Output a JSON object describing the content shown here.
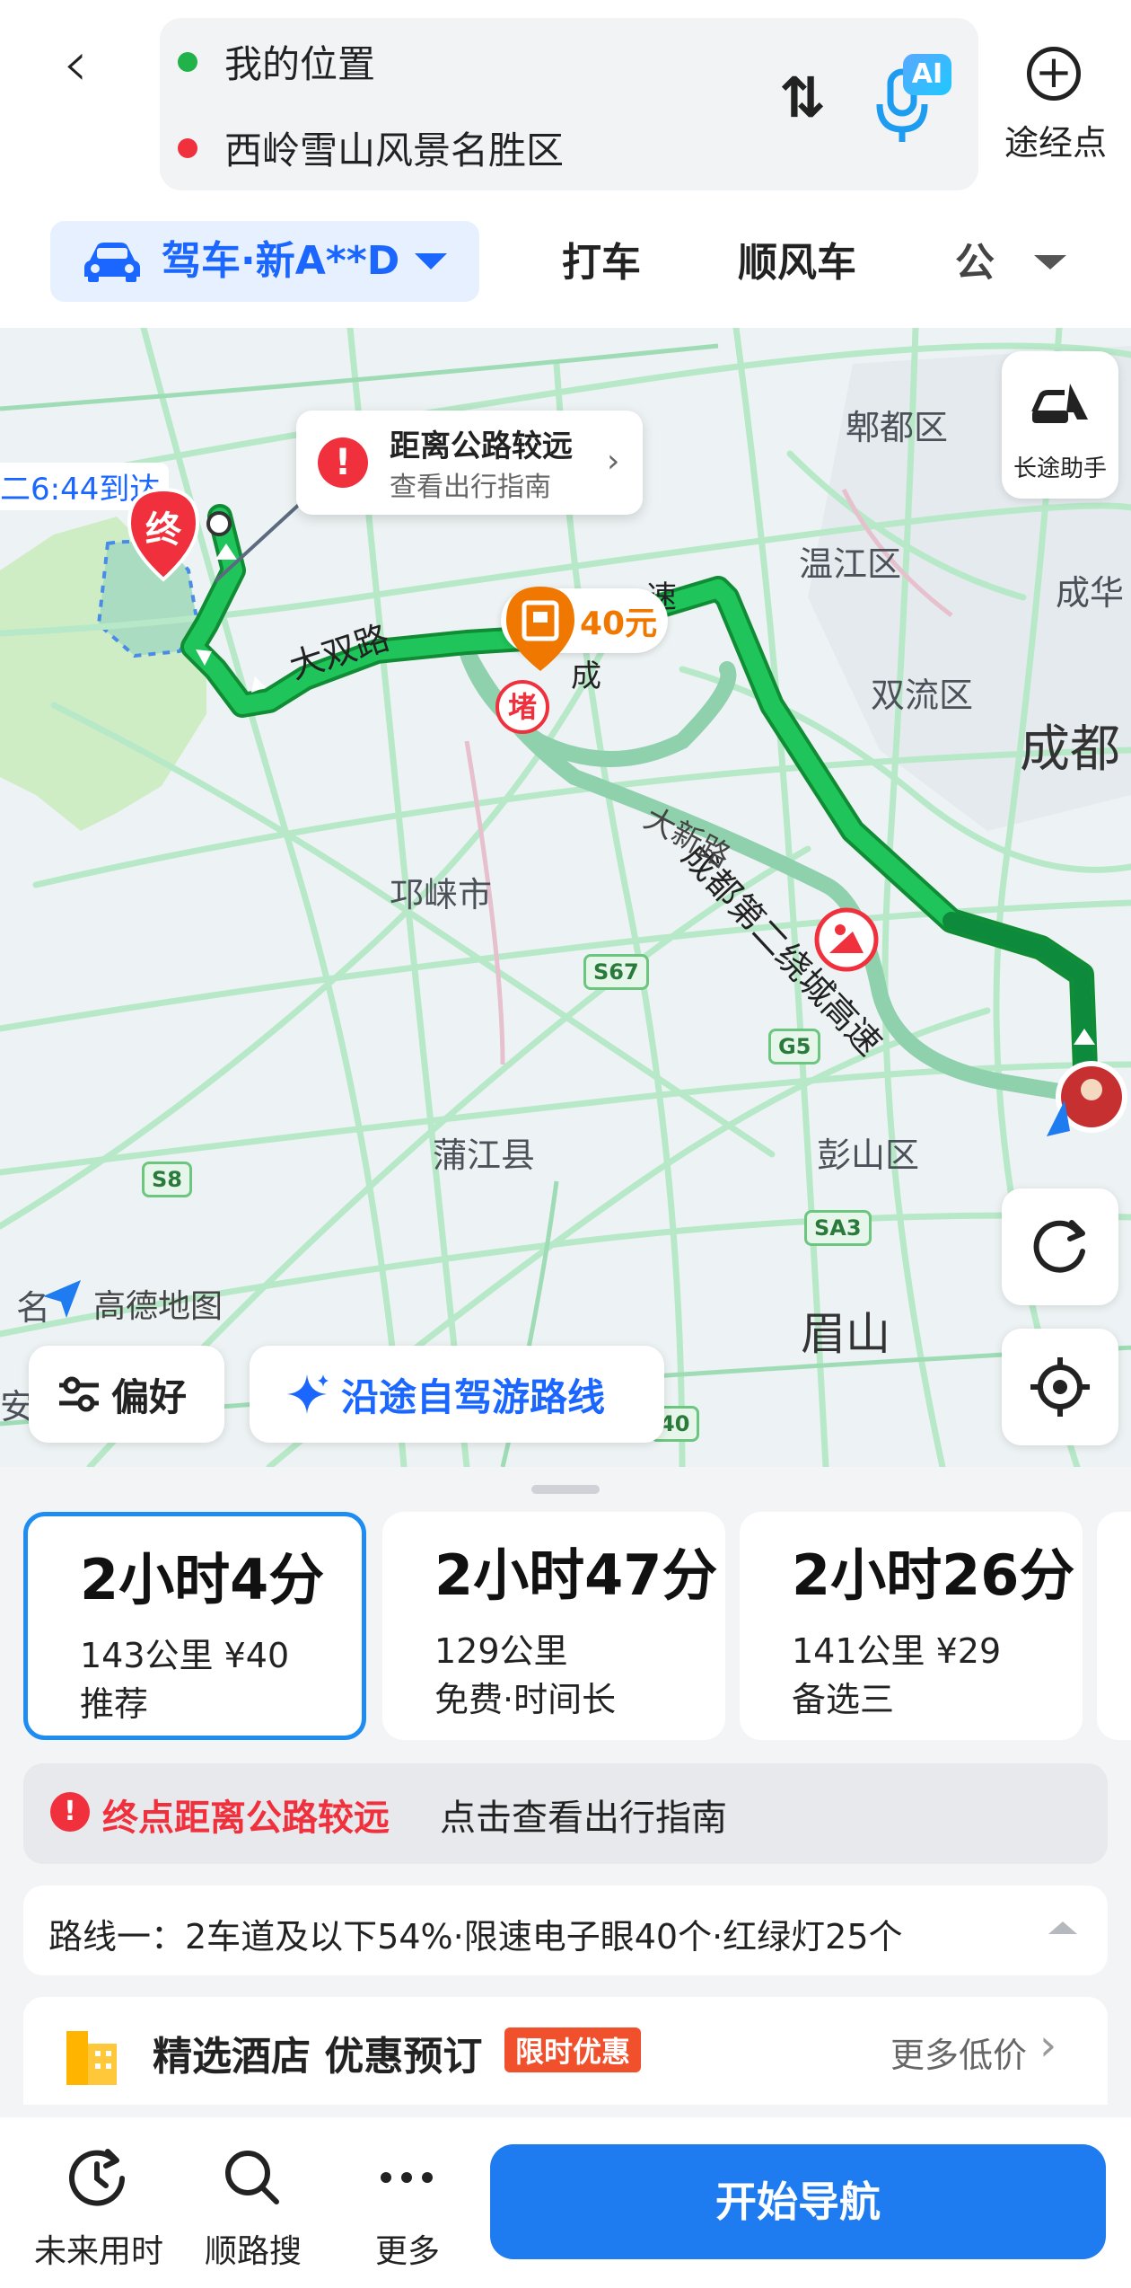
{
  "header": {
    "origin": "我的位置",
    "destination": "西岭雪山风景名胜区",
    "ai_badge": "AI",
    "add_waypoint_label": "途经点",
    "origin_color": "#21b34a",
    "destination_color": "#f0303c"
  },
  "mode_tabs": {
    "drive": "驾车·新A**D",
    "taxi": "打车",
    "carpool": "顺风车",
    "transit_partial": "公"
  },
  "map": {
    "brand": "高德地图",
    "arrival_partial": "二6:44到达",
    "end_marker": "终",
    "congestion_marker": "堵",
    "toll_label": "40元",
    "callout_title": "距离公路较远",
    "callout_sub": "查看出行指南",
    "long_trip_label": "长途助手",
    "district_labels": [
      "郫都区",
      "温江区",
      "成华",
      "双流区",
      "成都",
      "邛崃市",
      "蒲江县",
      "彭山区",
      "眉山",
      "名",
      "安"
    ],
    "road_labels": [
      "大双路",
      "成都第二绕城高速",
      "大新路",
      "速",
      "成"
    ],
    "road_shields": [
      "S67",
      "G5",
      "S8",
      "SA3",
      "40"
    ],
    "preference_label": "偏好",
    "trip_route_label": "沿途自驾游路线",
    "route_colors": {
      "selected": "#1eb84a",
      "alt": "#8fd0ad"
    }
  },
  "routes": [
    {
      "time": "2小时4分",
      "detail": "143公里 ¥40",
      "tag": "推荐",
      "selected": true
    },
    {
      "time": "2小时47分",
      "detail": "129公里",
      "tag": "免费·时间长",
      "selected": false
    },
    {
      "time": "2小时26分",
      "detail": "141公里 ¥29",
      "tag": "备选三",
      "selected": false
    }
  ],
  "warning": {
    "highlight": "终点距离公路较远",
    "action": "点击查看出行指南"
  },
  "route_info": "路线一：2车道及以下54%·限速电子眼40个·红绿灯25个",
  "hotel": {
    "title": "精选酒店 优惠预订",
    "badge": "限时优惠",
    "more": "更多低价"
  },
  "bottom_bar": {
    "future_time": "未来用时",
    "along_search": "顺路搜",
    "more": "更多",
    "start_nav": "开始导航",
    "accent": "#1e7bf0"
  }
}
